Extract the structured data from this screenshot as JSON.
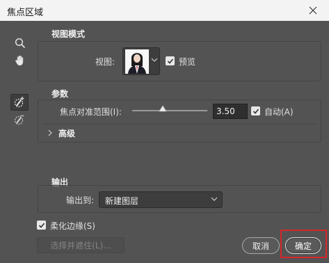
{
  "window": {
    "title": "焦点区域"
  },
  "tools": {
    "zoom_icon": "magnifier",
    "hand_icon": "hand",
    "add_brush_icon": "focus-area-add",
    "subtract_brush_icon": "focus-area-subtract"
  },
  "view_mode": {
    "title": "视图模式",
    "view_label": "视图:",
    "preview_label": "预览",
    "preview_checked": true
  },
  "parameters": {
    "title": "参数",
    "range_label": "焦点对准范围(I):",
    "range_value": "3.50",
    "range_fraction": 0.41,
    "auto_label": "自动(A)",
    "auto_checked": true,
    "advanced_label": "高级"
  },
  "output": {
    "title": "输出",
    "output_to_label": "输出到:",
    "output_to_value": "新建图层",
    "soften_label": "柔化边缘(S)",
    "soften_checked": true
  },
  "buttons": {
    "select_and_mask": "选择并遮住(L)...",
    "cancel": "取消",
    "ok": "确定"
  },
  "colors": {
    "highlight": "#d8262c",
    "background": "#535353"
  }
}
